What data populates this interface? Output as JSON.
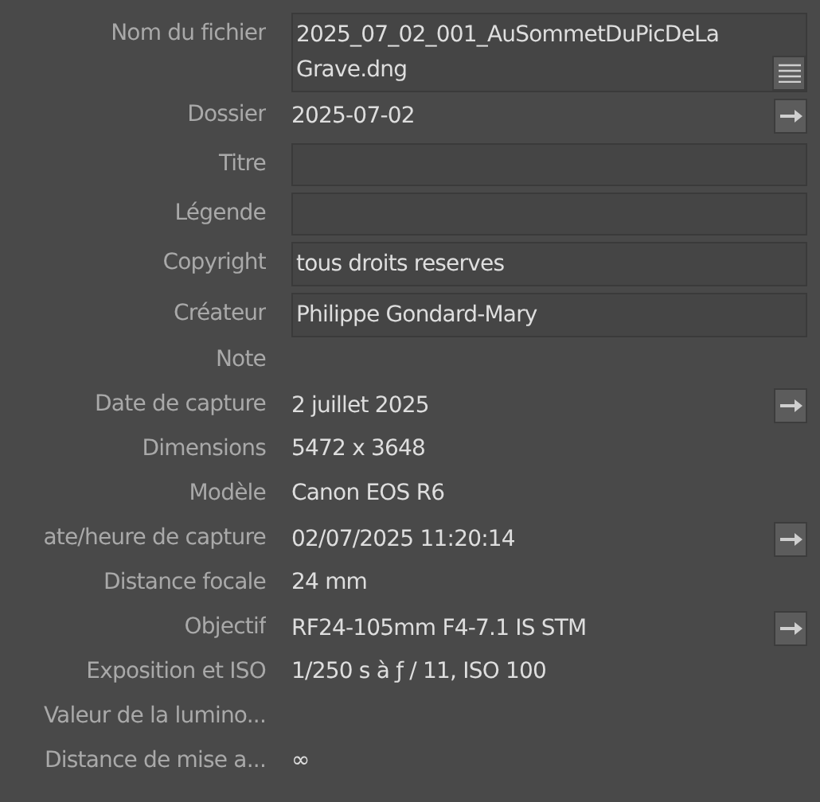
{
  "rows": [
    {
      "label": "Nom du fichier",
      "kind": "field",
      "value": "2025_07_02_001_AuSommetDuPicDeLa Grave.dng",
      "button": {
        "kind": "list"
      }
    },
    {
      "label": "Dossier",
      "kind": "text",
      "value": "2025-07-02",
      "button": {
        "kind": "arrow"
      }
    },
    {
      "label": "Titre",
      "kind": "field"
    },
    {
      "label": "Légende",
      "kind": "field"
    },
    {
      "label": "Copyright",
      "kind": "field",
      "value": "tous droits reserves"
    },
    {
      "label": "Créateur",
      "kind": "field",
      "value": "Philippe Gondard-Mary"
    },
    {
      "label": "Note",
      "kind": "text"
    },
    {
      "label": "Date de capture",
      "kind": "text",
      "value": "2 juillet 2025",
      "button": {
        "kind": "arrow"
      }
    },
    {
      "label": "Dimensions",
      "kind": "text",
      "value": "5472 x 3648"
    },
    {
      "label": "Modèle",
      "kind": "text",
      "value": "Canon EOS R6"
    },
    {
      "label": "ate/heure de capture",
      "kind": "text",
      "value": "02/07/2025 11:20:14",
      "button": {
        "kind": "arrow"
      }
    },
    {
      "label": "Distance focale",
      "kind": "text",
      "value": "24 mm"
    },
    {
      "label": "Objectif",
      "kind": "text",
      "value": "RF24-105mm F4-7.1 IS STM",
      "button": {
        "kind": "arrow"
      }
    },
    {
      "label": "Exposition et ISO",
      "kind": "text",
      "value": "1/250 s à ƒ / 11, ISO 100"
    },
    {
      "label": "Valeur de la lumino...",
      "kind": "text"
    },
    {
      "label": "Distance de mise a...",
      "kind": "text",
      "value": "∞"
    }
  ]
}
